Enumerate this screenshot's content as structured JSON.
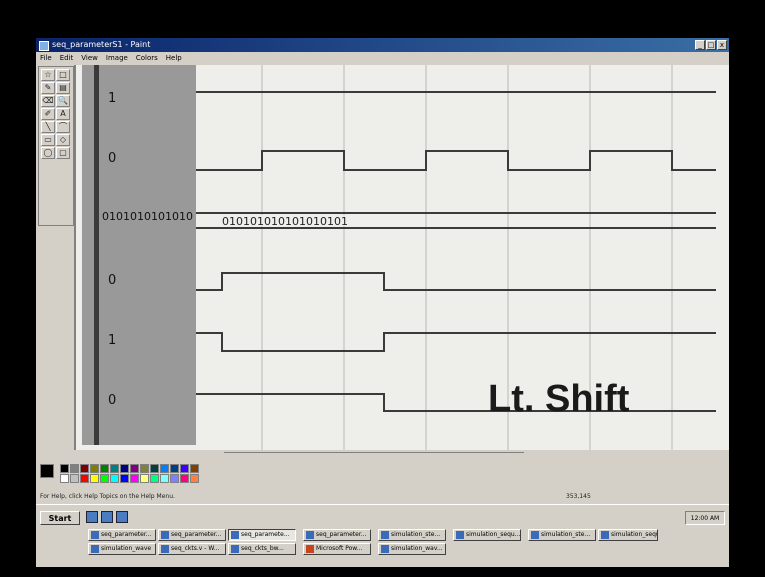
{
  "window": {
    "title": "seq_parameterS1 - Paint",
    "min": "_",
    "max": "□",
    "close": "x"
  },
  "menu": [
    "File",
    "Edit",
    "View",
    "Image",
    "Colors",
    "Help"
  ],
  "tools": [
    "☆",
    "□",
    "✎",
    "▤",
    "⌫",
    "🔍",
    "✐",
    "A",
    "╲",
    "⌒",
    "▭",
    "◇",
    "◯",
    "▢"
  ],
  "signals": [
    {
      "label": "1"
    },
    {
      "label": "0"
    },
    {
      "label": "0101010101010"
    },
    {
      "label": "0"
    },
    {
      "label": "1"
    },
    {
      "label": "0"
    }
  ],
  "bus_value": "010101010101010101",
  "overlay": "Lt. Shift",
  "palette_colors": [
    "#000000",
    "#808080",
    "#800000",
    "#808000",
    "#008000",
    "#008080",
    "#000080",
    "#800080",
    "#808040",
    "#004040",
    "#0080ff",
    "#004080",
    "#4000ff",
    "#804000",
    "#ffffff",
    "#c0c0c0",
    "#ff0000",
    "#ffff00",
    "#00ff00",
    "#00ffff",
    "#0000ff",
    "#ff00ff",
    "#ffff80",
    "#00ff80",
    "#80ffff",
    "#8080ff",
    "#ff0080",
    "#ff8040"
  ],
  "status": {
    "help": "For Help, click Help Topics on the Help Menu.",
    "coords": "353,145"
  },
  "taskbar": {
    "start": "Start",
    "clock": "12:00 AM",
    "buttons": [
      "seq_parameter...",
      "seq_parameter...",
      "seq_paramete...",
      "seq_parameter...",
      "simulation_ste...",
      "simulation_sequ...",
      "simulation_ste...",
      "simulation_sequ...",
      "simulation_wave",
      "seq_ckts.v - W...",
      "seq_ckts_bw...",
      "Microsoft Pow...",
      "simulation_wav..."
    ]
  }
}
